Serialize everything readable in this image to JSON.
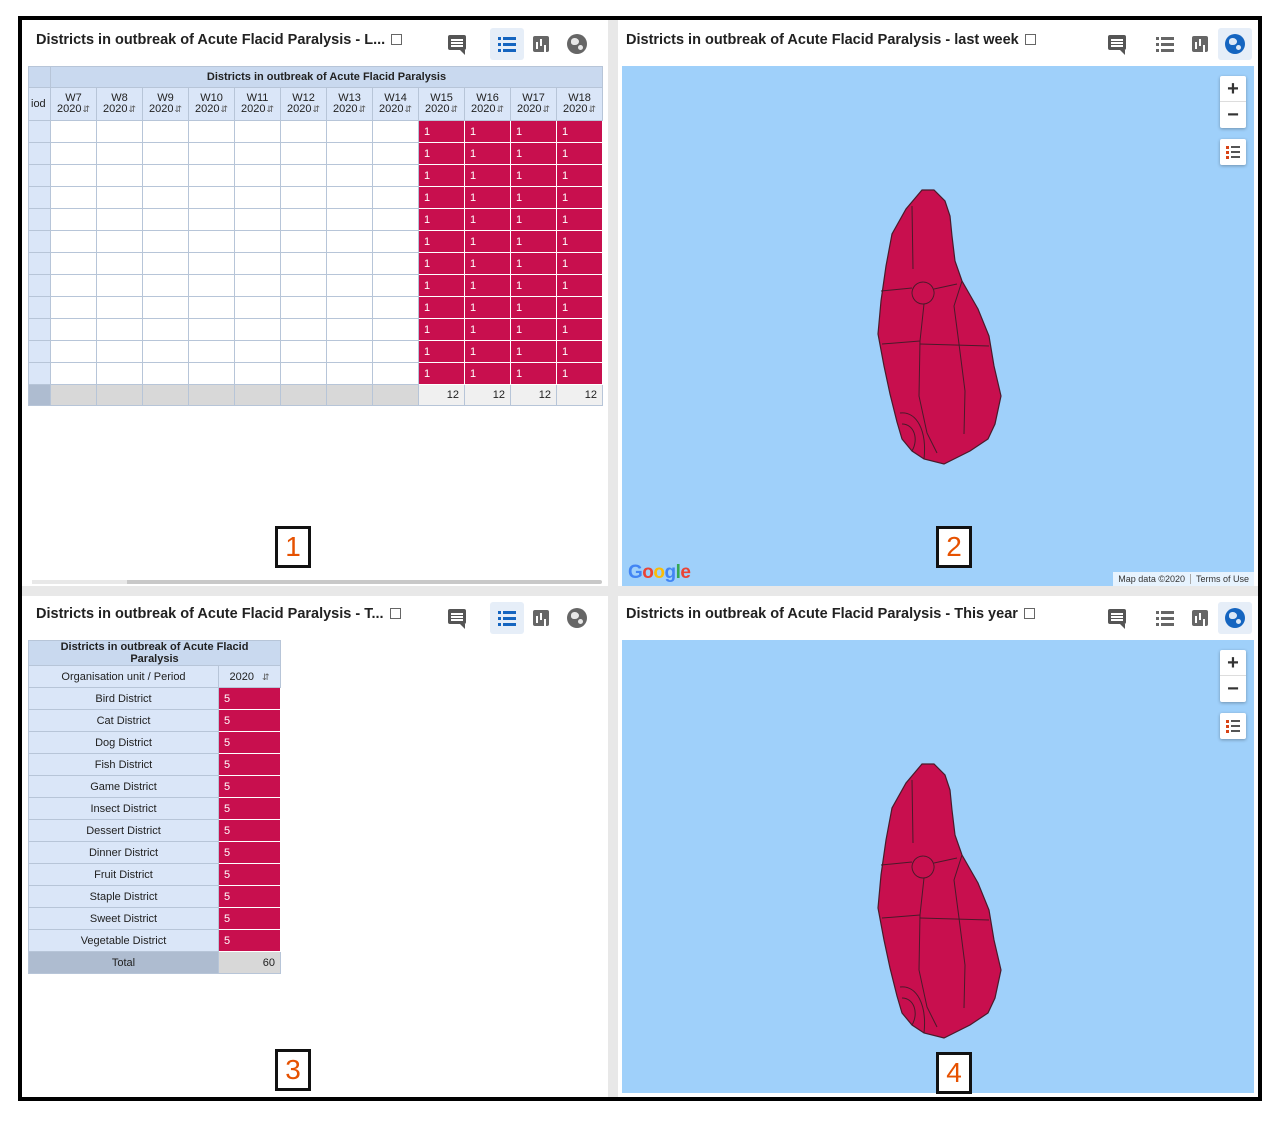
{
  "panels": {
    "p1": {
      "title": "Districts in outbreak of Acute Flacid Paralysis - L...",
      "table_title": "Districts in outbreak of Acute Flacid Paralysis",
      "period_header": "iod",
      "columns": [
        {
          "week": "W7",
          "year": "2020"
        },
        {
          "week": "W8",
          "year": "2020"
        },
        {
          "week": "W9",
          "year": "2020"
        },
        {
          "week": "W10",
          "year": "2020"
        },
        {
          "week": "W11",
          "year": "2020"
        },
        {
          "week": "W12",
          "year": "2020"
        },
        {
          "week": "W13",
          "year": "2020"
        },
        {
          "week": "W14",
          "year": "2020"
        },
        {
          "week": "W15",
          "year": "2020"
        },
        {
          "week": "W16",
          "year": "2020"
        },
        {
          "week": "W17",
          "year": "2020"
        },
        {
          "week": "W18",
          "year": "2020"
        }
      ],
      "cell_value": "1",
      "row_count": 12,
      "filled_from_index": 8,
      "totals": [
        "",
        "",
        "",
        "",
        "",
        "",
        "",
        "",
        "12",
        "12",
        "12",
        "12"
      ]
    },
    "p2": {
      "title": "Districts in outbreak of Acute Flacid Paralysis - last week",
      "map_data": "Map data ©2020",
      "terms": "Terms of Use"
    },
    "p3": {
      "title": "Districts in outbreak of Acute Flacid Paralysis - T...",
      "table_title": "Districts in outbreak of Acute Flacid Paralysis",
      "ou_header": "Organisation unit / Period",
      "year_header": "2020",
      "rows": [
        {
          "name": "Bird District",
          "value": "5"
        },
        {
          "name": "Cat District",
          "value": "5"
        },
        {
          "name": "Dog District",
          "value": "5"
        },
        {
          "name": "Fish District",
          "value": "5"
        },
        {
          "name": "Game District",
          "value": "5"
        },
        {
          "name": "Insect District",
          "value": "5"
        },
        {
          "name": "Dessert District",
          "value": "5"
        },
        {
          "name": "Dinner District",
          "value": "5"
        },
        {
          "name": "Fruit District",
          "value": "5"
        },
        {
          "name": "Staple District",
          "value": "5"
        },
        {
          "name": "Sweet District",
          "value": "5"
        },
        {
          "name": "Vegetable District",
          "value": "5"
        }
      ],
      "total_label": "Total",
      "total_value": "60"
    },
    "p4": {
      "title": "Districts in outbreak of Acute Flacid Paralysis - This year"
    }
  },
  "map": {
    "zoom_in": "+",
    "zoom_out": "−",
    "google": [
      "G",
      "o",
      "o",
      "g",
      "l",
      "e"
    ],
    "google_colors": [
      "#4285f4",
      "#ea4335",
      "#fbbc05",
      "#4285f4",
      "#34a853",
      "#ea4335"
    ],
    "fill_color": "#c80f4e",
    "water_color": "#9fd0fa"
  },
  "badges": [
    "1",
    "2",
    "3",
    "4"
  ],
  "icons": [
    "comment-icon",
    "table-icon",
    "chart-icon",
    "globe-icon",
    "external-link-icon",
    "legend-icon"
  ]
}
